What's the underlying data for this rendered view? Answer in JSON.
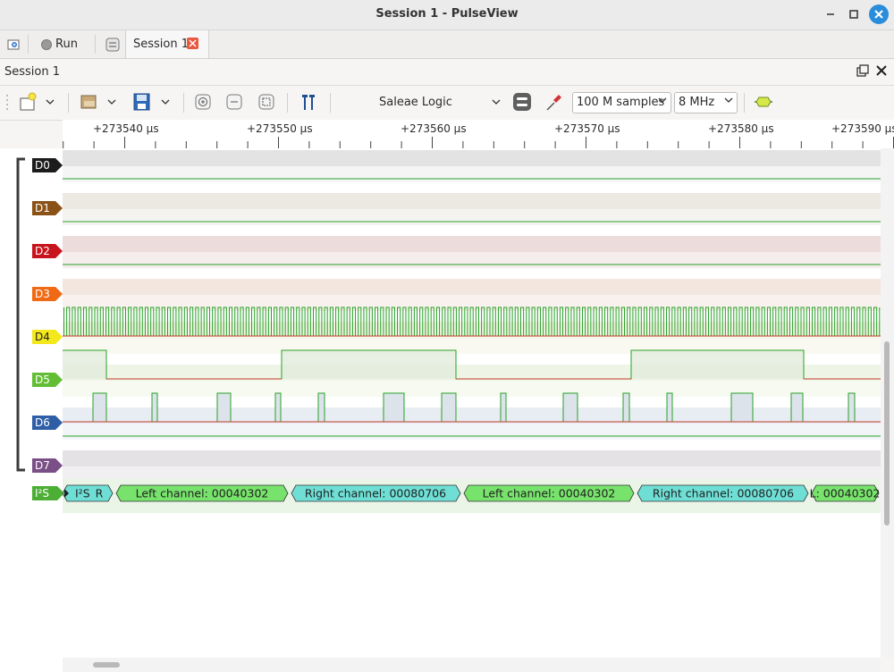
{
  "window": {
    "title": "Session 1 - PulseView"
  },
  "tabbar": {
    "run_label": "Run",
    "session_tab_label": "Session 1"
  },
  "dock": {
    "title": "Session 1"
  },
  "toolbar": {
    "device": "Saleae Logic",
    "samples": "100 M samples",
    "samplerate": "8 MHz"
  },
  "ruler": {
    "ticks": [
      "+273540 µs",
      "+273550 µs",
      "+273560 µs",
      "+273570 µs",
      "+273580 µs",
      "+273590 µs"
    ]
  },
  "channels": [
    {
      "name": "D0",
      "color": "#1c1c1c"
    },
    {
      "name": "D1",
      "color": "#8b5215"
    },
    {
      "name": "D2",
      "color": "#c8141d"
    },
    {
      "name": "D3",
      "color": "#f06a16"
    },
    {
      "name": "D4",
      "color": "#f3e81b"
    },
    {
      "name": "D5",
      "color": "#63bd35"
    },
    {
      "name": "D6",
      "color": "#2d5ea6"
    },
    {
      "name": "D7",
      "color": "#7a4f87"
    }
  ],
  "decoder": {
    "name": "I²S",
    "color": "#4cae34",
    "annotations": [
      {
        "text": "I²S",
        "kind": "small"
      },
      {
        "text": "R",
        "kind": "right"
      },
      {
        "text": "Left channel: 00040302",
        "kind": "left"
      },
      {
        "text": "Right channel: 00080706",
        "kind": "right"
      },
      {
        "text": "Left channel: 00040302",
        "kind": "left"
      },
      {
        "text": "Right channel: 00080706",
        "kind": "right"
      },
      {
        "text": "L: 00040302",
        "kind": "left"
      }
    ],
    "left_color": "#78e36c",
    "right_color": "#6fdfd6"
  }
}
